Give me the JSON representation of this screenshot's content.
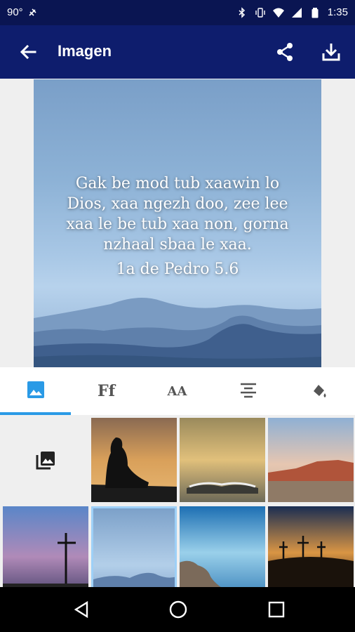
{
  "status_bar": {
    "left_text": "90°",
    "time": "1:35",
    "icons": [
      "vibration-off-icon",
      "bluetooth-icon",
      "vibrate-icon",
      "wifi-icon",
      "signal-icon",
      "battery-icon"
    ]
  },
  "app_bar": {
    "title": "Imagen",
    "back_icon": "arrow-back-icon",
    "share_icon": "share-icon",
    "download_icon": "download-icon"
  },
  "preview": {
    "verse": "Gak be mod tub xaawin lo Dios, xaa ngezh doo, zee lee xaa le be tub xaa non, gorna nzhaal sbaa le xaa.",
    "reference": "1a de Pedro 5.6"
  },
  "tabs": [
    {
      "name": "image",
      "icon": "image-icon",
      "label": ""
    },
    {
      "name": "font",
      "icon": "font-icon",
      "label": "Ff"
    },
    {
      "name": "text-size",
      "icon": "text-size-icon",
      "label": "AA"
    },
    {
      "name": "alignment",
      "icon": "align-center-icon",
      "label": ""
    },
    {
      "name": "color",
      "icon": "paint-bucket-icon",
      "label": ""
    }
  ],
  "active_tab": "image",
  "thumbnails": [
    {
      "name": "gallery",
      "icon": "gallery-icon"
    },
    {
      "name": "reading-silhouette"
    },
    {
      "name": "open-book-sunset"
    },
    {
      "name": "red-rock-canyon"
    },
    {
      "name": "cross-dusk"
    },
    {
      "name": "blue-mountains",
      "selected": true
    },
    {
      "name": "rocky-shore"
    },
    {
      "name": "three-crosses-sunset"
    }
  ],
  "colors": {
    "status_bar": "#0a1552",
    "app_bar": "#0e1d6d",
    "accent": "#2a9ae6"
  }
}
